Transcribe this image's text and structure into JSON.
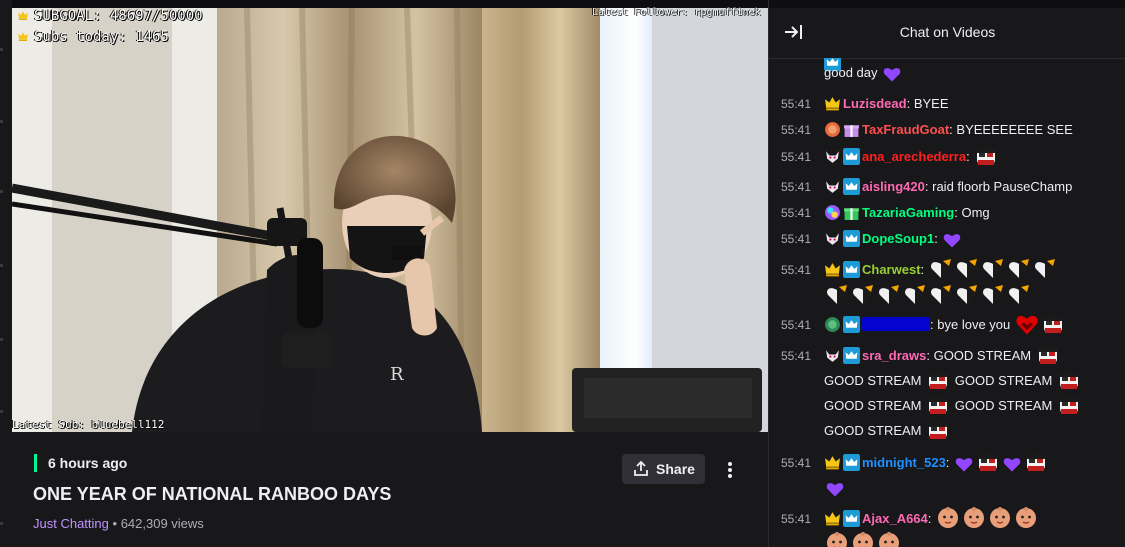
{
  "overlay": {
    "subgoal": "SUBGOAL: 48697/50000",
    "subs_today": "Subs today: 1465",
    "latest_follower": "Latest Follower: rpgmuffinek",
    "latest_sub": "Latest Sub: bluebell112"
  },
  "video_info": {
    "age": "6 hours ago",
    "title": "ONE YEAR OF NATIONAL RANBOO DAYS",
    "category": "Just Chatting",
    "separator": "•",
    "views": "642,309 views",
    "share_label": "Share",
    "icons": [
      "share-icon",
      "more-vertical-icon"
    ]
  },
  "chat": {
    "title": "Chat on Videos",
    "collapse_icon": "collapse-right-icon",
    "messages": [
      {
        "text": "good day"
      },
      {
        "time": "55:41",
        "user": "Luzisdead",
        "sep": ":",
        "text": "BYEE",
        "color": "#ff69b4"
      },
      {
        "time": "55:41",
        "user": "TaxFraudGoat",
        "sep": ":",
        "text": "BYEEEEEEEE SEE",
        "color": "#ff4f4f"
      },
      {
        "time": "55:41",
        "user": "ana_arechederra",
        "sep": ":",
        "text": "",
        "color": "#ff1f1f"
      },
      {
        "time": "55:41",
        "user": "aisling420",
        "sep": ":",
        "text": "raid floorb PauseChamp",
        "color": "#ff69b4"
      },
      {
        "time": "55:41",
        "user": "TazariaGaming",
        "sep": ":",
        "text": "Omg",
        "color": "#00ff7f"
      },
      {
        "time": "55:41",
        "user": "DopeSoup1",
        "sep": ":",
        "text": "",
        "color": "#00ff7f"
      },
      {
        "time": "55:41",
        "user": "Charwest",
        "sep": ":",
        "text": "",
        "color": "#9acd32"
      },
      {
        "time": "55:41",
        "user": "",
        "sep": ":",
        "text": "bye love you",
        "color": "#0000ff"
      },
      {
        "time": "55:41",
        "user": "sra_draws",
        "sep": ":",
        "text": "GOOD STREAM",
        "color": "#ff69b4"
      },
      {
        "text": "GOOD STREAM"
      },
      {
        "text": "GOOD STREAM"
      },
      {
        "text": "GOOD STREAM"
      },
      {
        "text": "GOOD STREAM"
      },
      {
        "text": "GOOD STREAM"
      },
      {
        "time": "55:41",
        "user": "midnight_523",
        "sep": ":",
        "text": "",
        "color": "#1e90ff"
      },
      {
        "time": "55:41",
        "user": "Ajax_A664",
        "sep": ":",
        "text": "",
        "color": "#ff69b4"
      }
    ]
  },
  "colors": {
    "accent_purple": "#bf94ff",
    "live_green": "#00f593",
    "bg_dark": "#0e0e10",
    "panel": "#18181b"
  }
}
